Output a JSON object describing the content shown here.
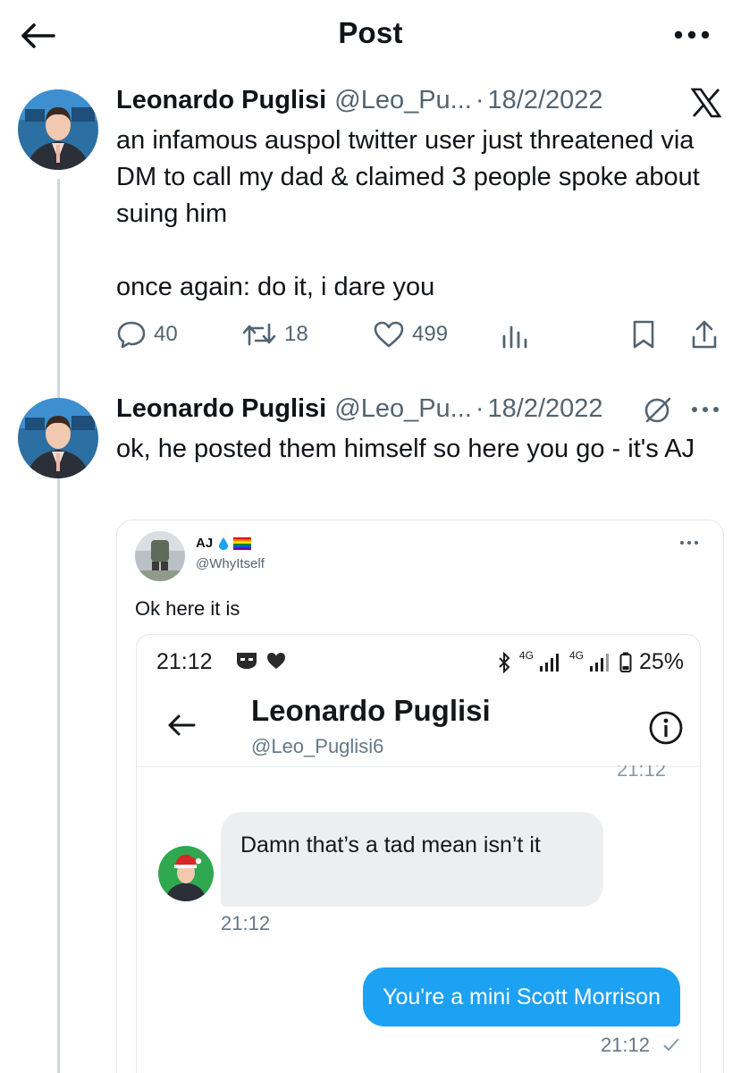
{
  "header": {
    "title": "Post"
  },
  "tweets": [
    {
      "name": "Leonardo Puglisi",
      "handle": "@Leo_Pu...",
      "dot": "·",
      "date": "18/2/2022",
      "text_lines": [
        "an infamous auspol twitter user just threatened via DM to call my dad & claimed 3 people spoke about suing him",
        "once again: do it, i dare you"
      ],
      "replies": "40",
      "reposts": "18",
      "likes": "499"
    },
    {
      "name": "Leonardo Puglisi",
      "handle": "@Leo_Pu...",
      "dot": "·",
      "date": "18/2/2022",
      "text": "ok, he posted them himself so here you go - it's AJ"
    }
  ],
  "quoted": {
    "name": "AJ",
    "handle": "@WhyItself",
    "text": "Ok here it is",
    "screenshot": {
      "status_time": "21:12",
      "battery": "25%",
      "network_1": "4G",
      "network_2": "4G",
      "dm_name": "Leonardo Puglisi",
      "dm_handle": "@Leo_Puglisi6",
      "cut_time": "21:12",
      "incoming": "Damn that’s a tad mean isn’t it",
      "incoming_time": "21:12",
      "outgoing": "You're a mini Scott Morrison",
      "outgoing_time": "21:12"
    }
  },
  "icons": {
    "back": "arrow-left-icon",
    "more": "more-horizontal-icon",
    "x_logo": "x-logo-icon",
    "reply": "reply-icon",
    "repost": "repost-icon",
    "like": "heart-icon",
    "views": "views-icon",
    "bookmark": "bookmark-icon",
    "share": "share-icon",
    "grok": "grok-icon"
  },
  "colors": {
    "accent": "#1da1f2",
    "muted": "#536471",
    "thread_line": "#cfd9de"
  }
}
